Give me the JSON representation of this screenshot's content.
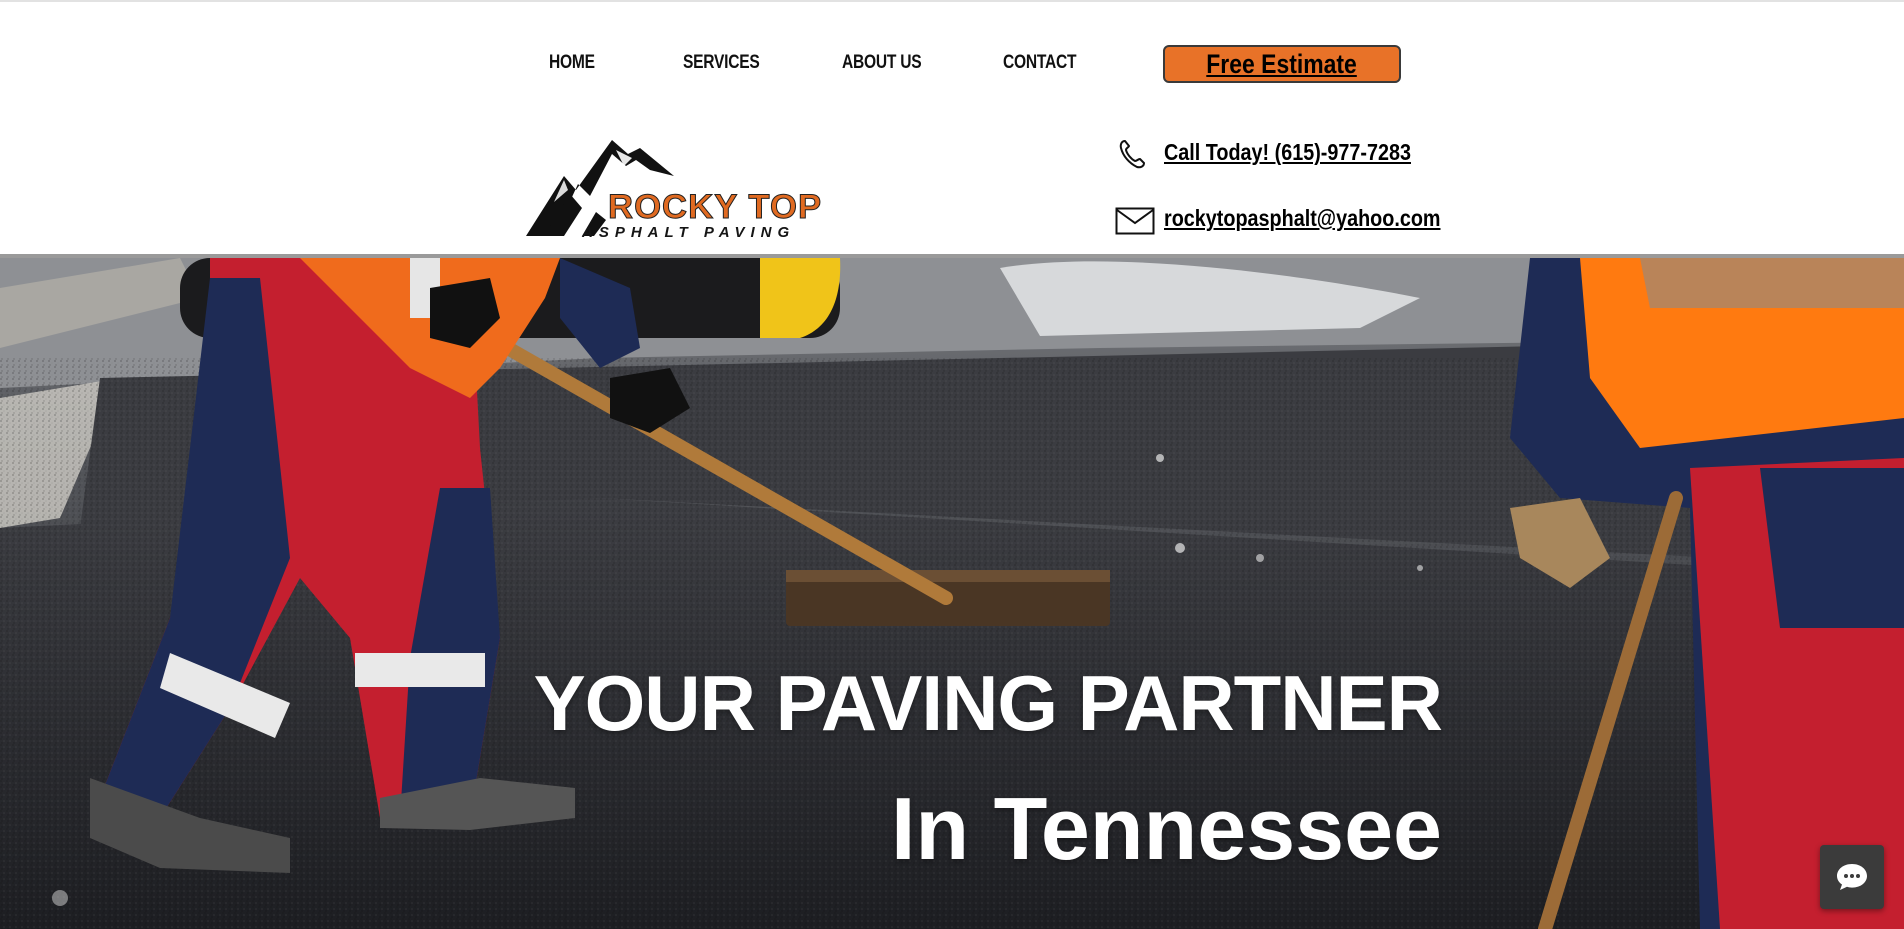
{
  "nav": {
    "items": [
      {
        "label": "HOME"
      },
      {
        "label": "SERVICES"
      },
      {
        "label": "ABOUT US"
      },
      {
        "label": "CONTACT"
      }
    ],
    "cta_label": "Free Estimate"
  },
  "logo": {
    "line1": "ROCKY TOP",
    "line2": "ASPHALT PAVING"
  },
  "contact": {
    "phone_label": "Call Today! (615)-977-7283",
    "email_label": "rockytopasphalt@yahoo.com"
  },
  "hero": {
    "title": "YOUR PAVING PARTNER",
    "subtitle": "In Tennessee"
  },
  "icons": {
    "phone": "phone-icon",
    "email": "envelope-icon",
    "chat": "chat-icon"
  },
  "colors": {
    "accent": "#e87228",
    "logo_orange": "#e06a21",
    "text": "#000000",
    "hero_text": "#ffffff",
    "chat_bg": "#3b3b3b"
  }
}
